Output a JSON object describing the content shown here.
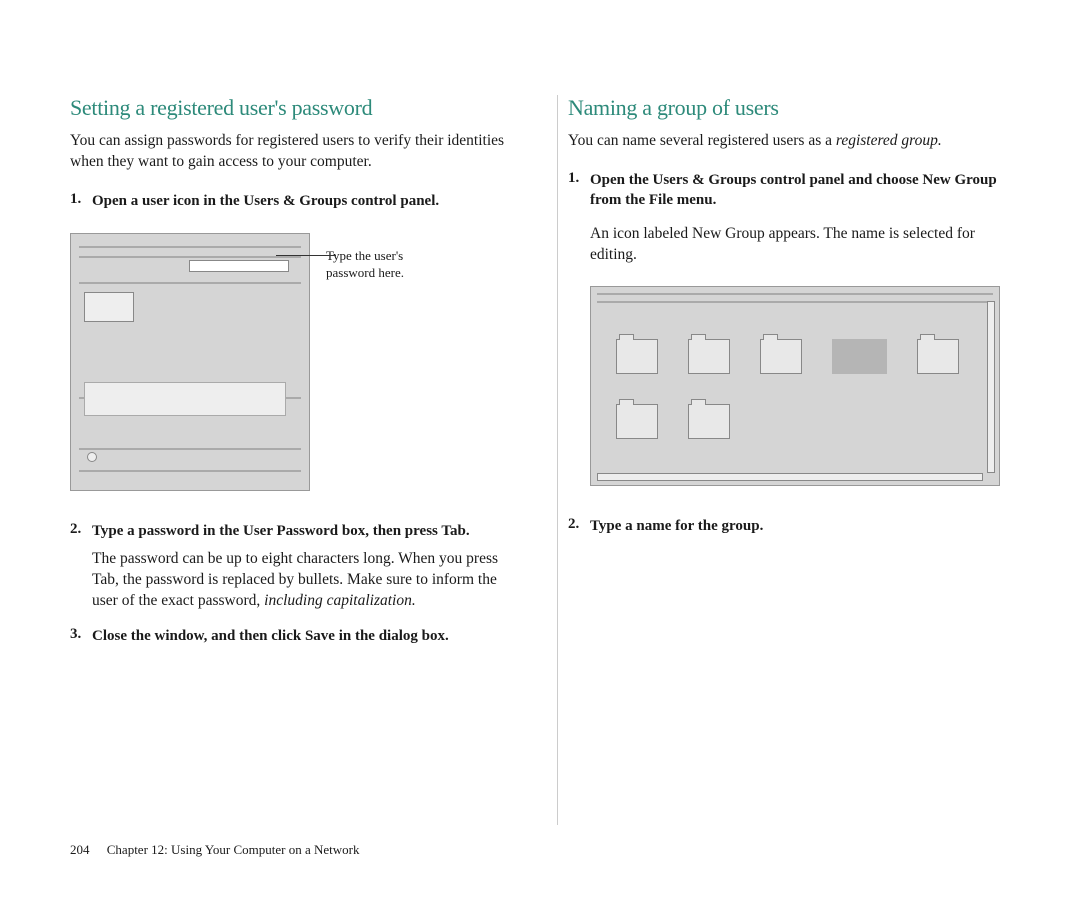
{
  "left": {
    "heading": "Setting a registered user's password",
    "intro": "You can assign passwords for registered users to verify their identities when they want to gain access to your computer.",
    "steps": [
      {
        "number": "1.",
        "title": "Open a user icon in the Users & Groups control panel."
      },
      {
        "number": "2.",
        "title": "Type a password in the User Password box, then press Tab.",
        "body_pre": "The password can be up to eight characters long. When you press Tab, the password is replaced by bullets. Make sure to inform the user of the exact password, ",
        "body_italic": "including capitalization.",
        "body_post": ""
      },
      {
        "number": "3.",
        "title": "Close the window, and then click Save in the dialog box."
      }
    ],
    "annotation": "Type the user's password here."
  },
  "right": {
    "heading": "Naming a group of users",
    "intro_pre": "You can name several registered users as a ",
    "intro_italic": "registered group.",
    "steps": [
      {
        "number": "1.",
        "title": "Open the Users & Groups control panel and choose New Group from the File menu.",
        "after": "An icon labeled New Group appears. The name is selected for editing."
      },
      {
        "number": "2.",
        "title": "Type a name for the group."
      }
    ]
  },
  "footer": {
    "page": "204",
    "chapter": "Chapter 12: Using Your Computer on a Network"
  }
}
